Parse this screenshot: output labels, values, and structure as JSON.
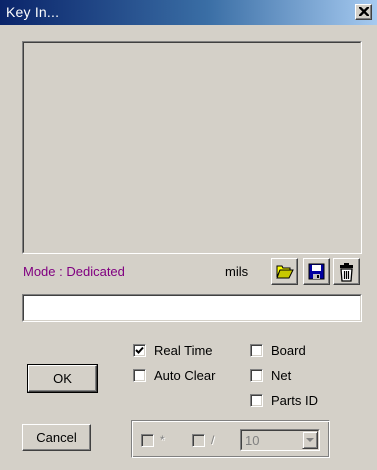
{
  "window": {
    "title": "Key In...",
    "close_icon": "close-icon"
  },
  "status": {
    "mode": "Mode : Dedicated",
    "units": "mils"
  },
  "toolbar": {
    "open_icon": "folder-open-icon",
    "save_icon": "floppy-disk-icon",
    "delete_icon": "trash-icon"
  },
  "input": {
    "value": "",
    "placeholder": ""
  },
  "buttons": {
    "ok": "OK",
    "cancel": "Cancel"
  },
  "options_left": [
    {
      "label": "Real Time",
      "checked": true
    },
    {
      "label": "Auto Clear",
      "checked": false
    }
  ],
  "options_right": [
    {
      "label": "Board",
      "checked": false
    },
    {
      "label": "Net",
      "checked": false
    },
    {
      "label": "Parts ID",
      "checked": false
    }
  ],
  "group": {
    "multiply_label": "*",
    "divide_label": "/",
    "combo_value": "10"
  },
  "colors": {
    "title_start": "#0a246a",
    "title_end": "#a6caf0",
    "mode_text": "#800080",
    "face": "#d4d0c8"
  }
}
